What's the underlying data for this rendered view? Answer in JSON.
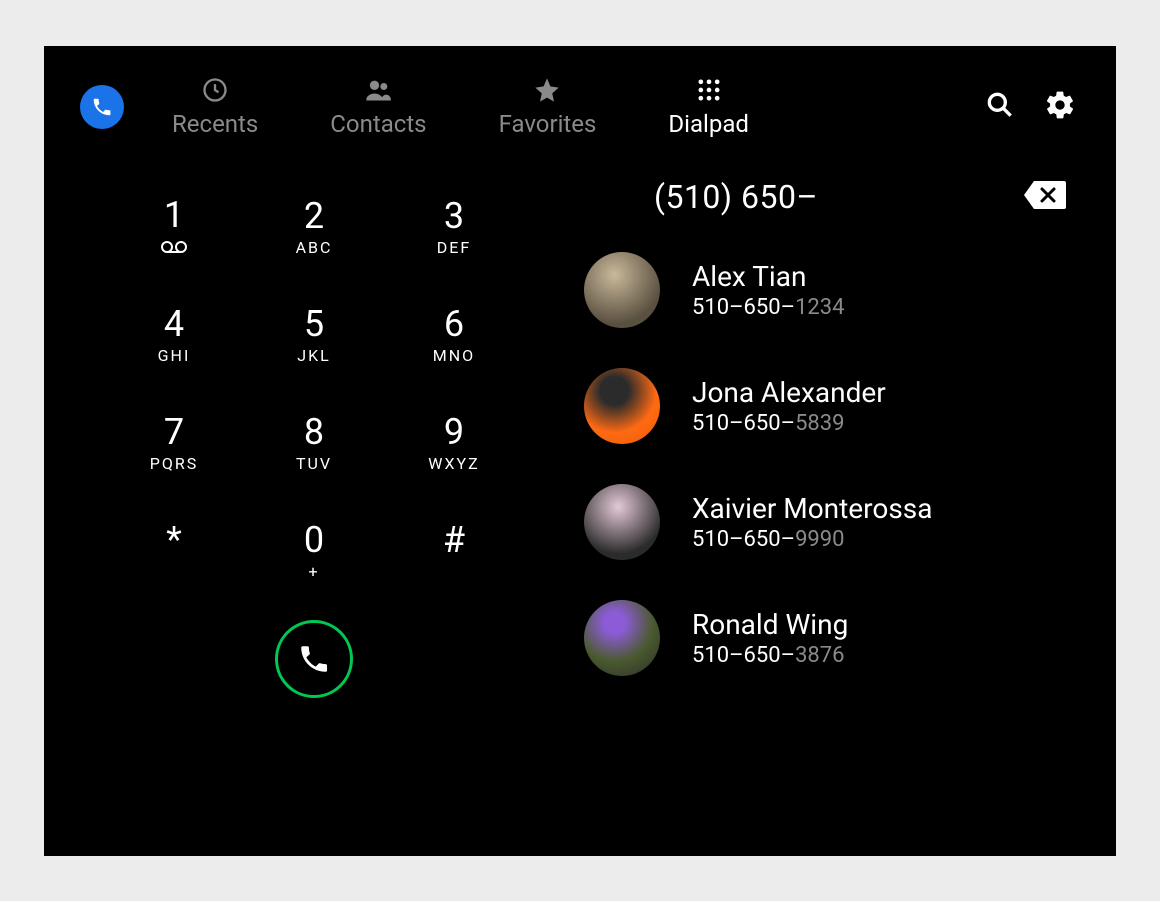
{
  "tabs": [
    {
      "label": "Recents",
      "icon": "clock-icon",
      "active": false
    },
    {
      "label": "Contacts",
      "icon": "people-icon",
      "active": false
    },
    {
      "label": "Favorites",
      "icon": "star-icon",
      "active": false
    },
    {
      "label": "Dialpad",
      "icon": "grid-icon",
      "active": true
    }
  ],
  "typed_number": "(510) 650–",
  "keys": [
    {
      "digit": "1",
      "letters": "",
      "voicemail": true
    },
    {
      "digit": "2",
      "letters": "ABC"
    },
    {
      "digit": "3",
      "letters": "DEF"
    },
    {
      "digit": "4",
      "letters": "GHI"
    },
    {
      "digit": "5",
      "letters": "JKL"
    },
    {
      "digit": "6",
      "letters": "MNO"
    },
    {
      "digit": "7",
      "letters": "PQRS"
    },
    {
      "digit": "8",
      "letters": "TUV"
    },
    {
      "digit": "9",
      "letters": "WXYZ"
    },
    {
      "digit": "*",
      "letters": ""
    },
    {
      "digit": "0",
      "letters": "+"
    },
    {
      "digit": "#",
      "letters": ""
    }
  ],
  "contacts": [
    {
      "name": "Alex Tian",
      "prefix": "510–650–",
      "rest": "1234"
    },
    {
      "name": "Jona Alexander",
      "prefix": "510–650–",
      "rest": "5839"
    },
    {
      "name": "Xaivier Monterossa",
      "prefix": "510–650–",
      "rest": "9990"
    },
    {
      "name": "Ronald Wing",
      "prefix": "510–650–",
      "rest": "3876"
    }
  ],
  "colors": {
    "accent_blue": "#1a73e8",
    "call_green": "#00c853",
    "inactive": "#8a8a8a"
  }
}
